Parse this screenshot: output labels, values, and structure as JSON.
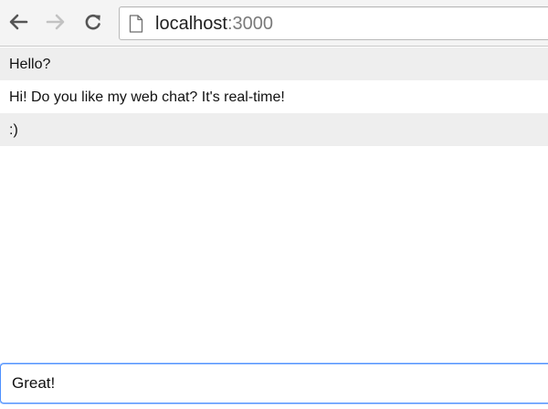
{
  "browser": {
    "url_host": "localhost",
    "url_port": ":3000",
    "icons": {
      "back": "back-arrow-icon",
      "forward": "forward-arrow-icon",
      "reload": "reload-icon",
      "page": "page-icon"
    }
  },
  "chat": {
    "messages": [
      {
        "text": "Hello?"
      },
      {
        "text": "Hi! Do you like my web chat? It's real-time!"
      },
      {
        "text": ":)"
      }
    ],
    "input_value": "Great!"
  },
  "colors": {
    "message_alt_bg": "#eeeeee",
    "focus_ring": "#4d90fe"
  }
}
